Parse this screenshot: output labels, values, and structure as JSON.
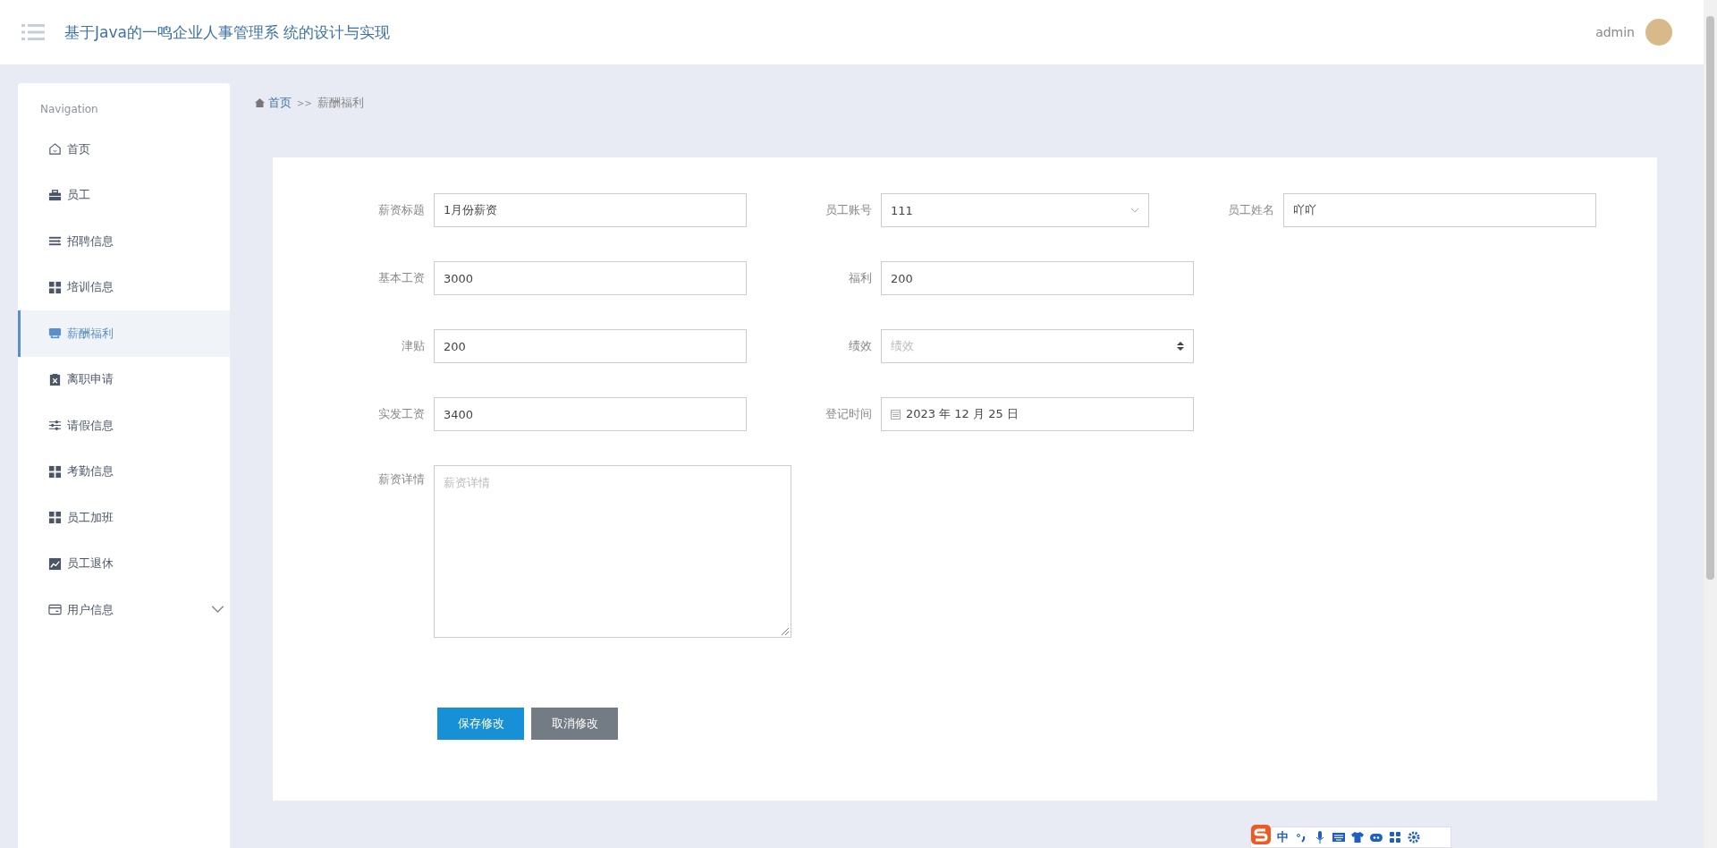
{
  "header": {
    "title": "基于Java的一鸣企业人事管理系 统的设计与实现",
    "user": "admin"
  },
  "sidebar": {
    "heading": "Navigation",
    "items": [
      {
        "label": "首页",
        "selected": false,
        "kind": "link"
      },
      {
        "label": "员工",
        "selected": false,
        "kind": "link"
      },
      {
        "label": "招聘信息",
        "selected": false,
        "kind": "link"
      },
      {
        "label": "培训信息",
        "selected": false,
        "kind": "link"
      },
      {
        "label": "薪酬福利",
        "selected": true,
        "kind": "link"
      },
      {
        "label": "离职申请",
        "selected": false,
        "kind": "link"
      },
      {
        "label": "请假信息",
        "selected": false,
        "kind": "link"
      },
      {
        "label": "考勤信息",
        "selected": false,
        "kind": "link"
      },
      {
        "label": "员工加班",
        "selected": false,
        "kind": "link"
      },
      {
        "label": "员工退休",
        "selected": false,
        "kind": "link"
      },
      {
        "label": "用户信息",
        "selected": false,
        "kind": "group"
      }
    ]
  },
  "breadcrumb": {
    "items": [
      "首页",
      "薪酬福利"
    ],
    "separator": ">>"
  },
  "form": {
    "rows": [
      [
        {
          "label": "薪资标题",
          "kind": "text",
          "value": "1月份薪资"
        },
        {
          "label": "员工账号",
          "kind": "select",
          "value": "111"
        },
        {
          "label": "员工姓名",
          "kind": "text",
          "value": "吖吖"
        }
      ],
      [
        {
          "label": "基本工资",
          "kind": "text",
          "value": "3000"
        },
        {
          "label": "福利",
          "kind": "text",
          "value": "200"
        }
      ],
      [
        {
          "label": "津贴",
          "kind": "text",
          "value": "200"
        },
        {
          "label": "绩效",
          "kind": "number",
          "placeholder": "绩效"
        }
      ],
      [
        {
          "label": "实发工资",
          "kind": "text",
          "value": "3400"
        },
        {
          "label": "登记时间",
          "kind": "date",
          "value": "2023 年 12 月 25 日"
        }
      ],
      [
        {
          "label": "薪资详情",
          "kind": "textarea",
          "placeholder": "薪资详情"
        }
      ]
    ],
    "buttons": [
      {
        "label": "保存修改",
        "kind": "primary"
      },
      {
        "label": "取消修改",
        "kind": "secondary"
      }
    ]
  },
  "ime_toolbar": {
    "mode": "中"
  }
}
